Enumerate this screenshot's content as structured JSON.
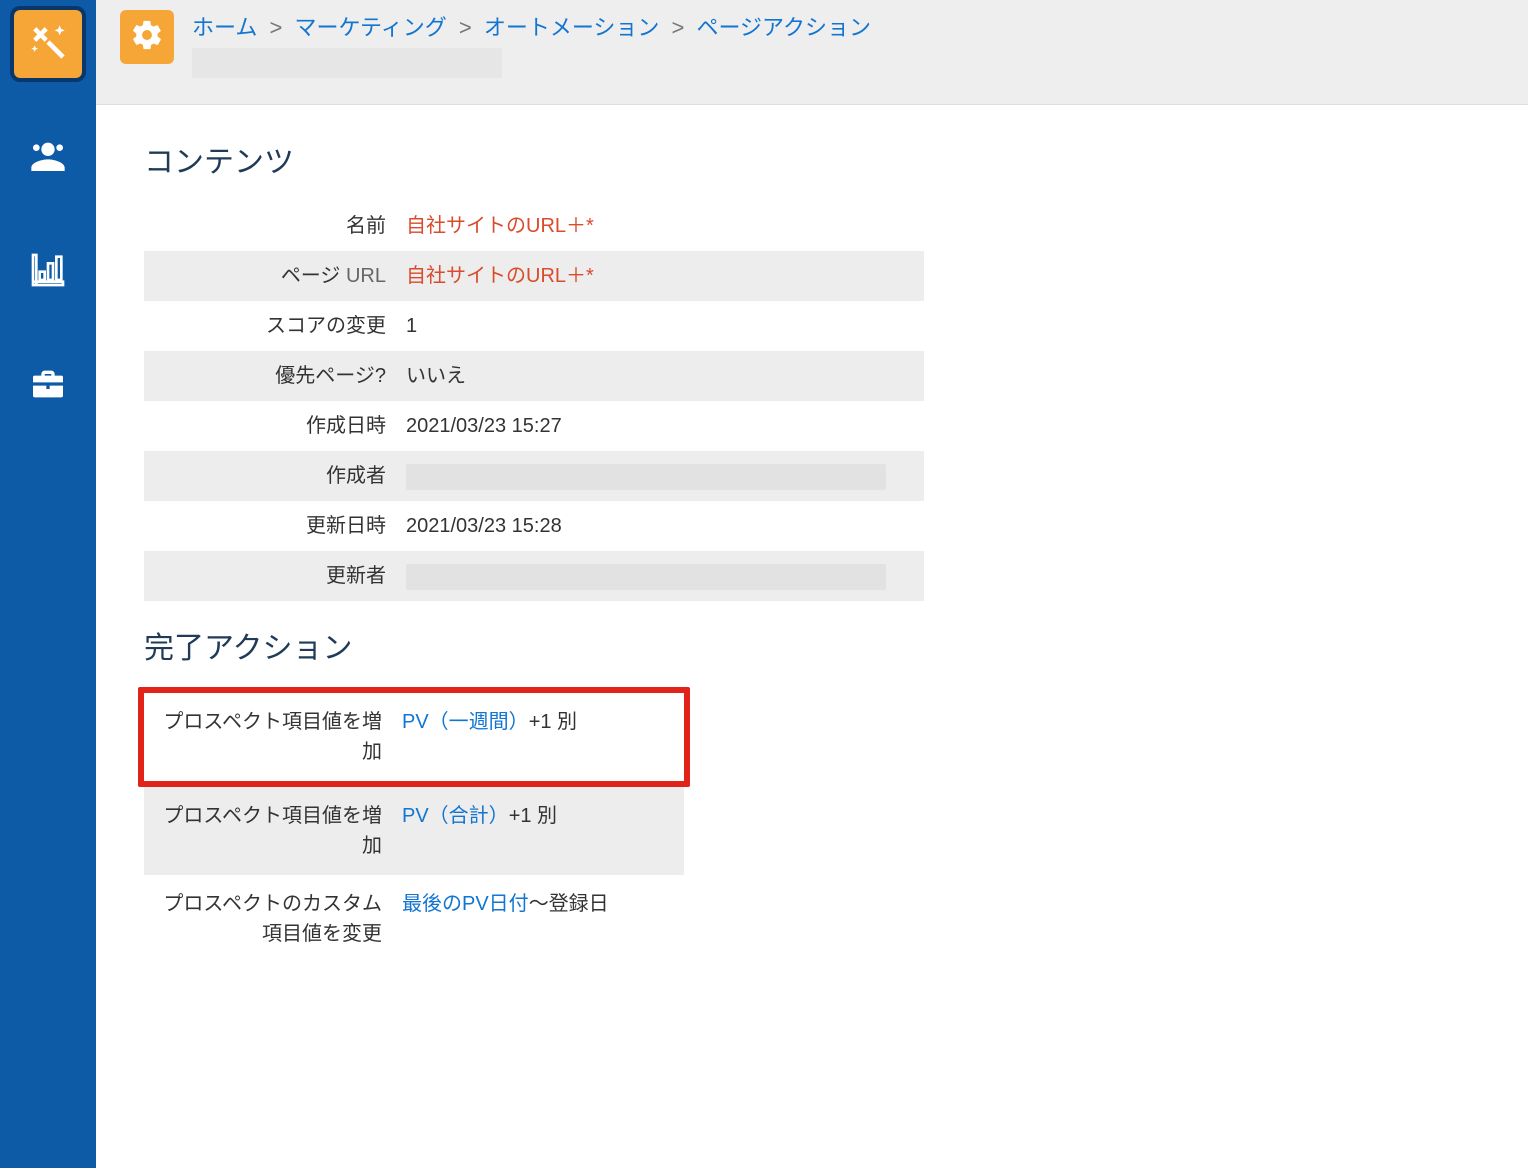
{
  "breadcrumb": {
    "items": [
      "ホーム",
      "マーケティング",
      "オートメーション",
      "ページアクション"
    ]
  },
  "sections": {
    "content_title": "コンテンツ",
    "actions_title": "完了アクション"
  },
  "content_rows": {
    "name_label": "名前",
    "name_value": "自社サイトのURL＋*",
    "page_url_label_a": "ページ",
    "page_url_label_b": " URL",
    "page_url_value": "自社サイトのURL＋*",
    "score_label": "スコアの変更",
    "score_value": "1",
    "priority_label": "優先ページ?",
    "priority_value": "いいえ",
    "created_at_label": "作成日時",
    "created_at_value": "2021/03/23 15:27",
    "creator_label": "作成者",
    "updated_at_label": "更新日時",
    "updated_at_value": "2021/03/23 15:28",
    "updater_label": "更新者"
  },
  "action_rows": [
    {
      "label": "プロスペクト項目値を増加",
      "link": "PV（一週間）",
      "suffix": "+1 別",
      "highlighted": true
    },
    {
      "label": "プロスペクト項目値を増加",
      "link": "PV（合計）",
      "suffix": "+1 別",
      "highlighted": false
    },
    {
      "label": "プロスペクトのカスタム項目値を変更",
      "link": "最後のPV日付",
      "suffix": "～登録日",
      "highlighted": false
    }
  ]
}
